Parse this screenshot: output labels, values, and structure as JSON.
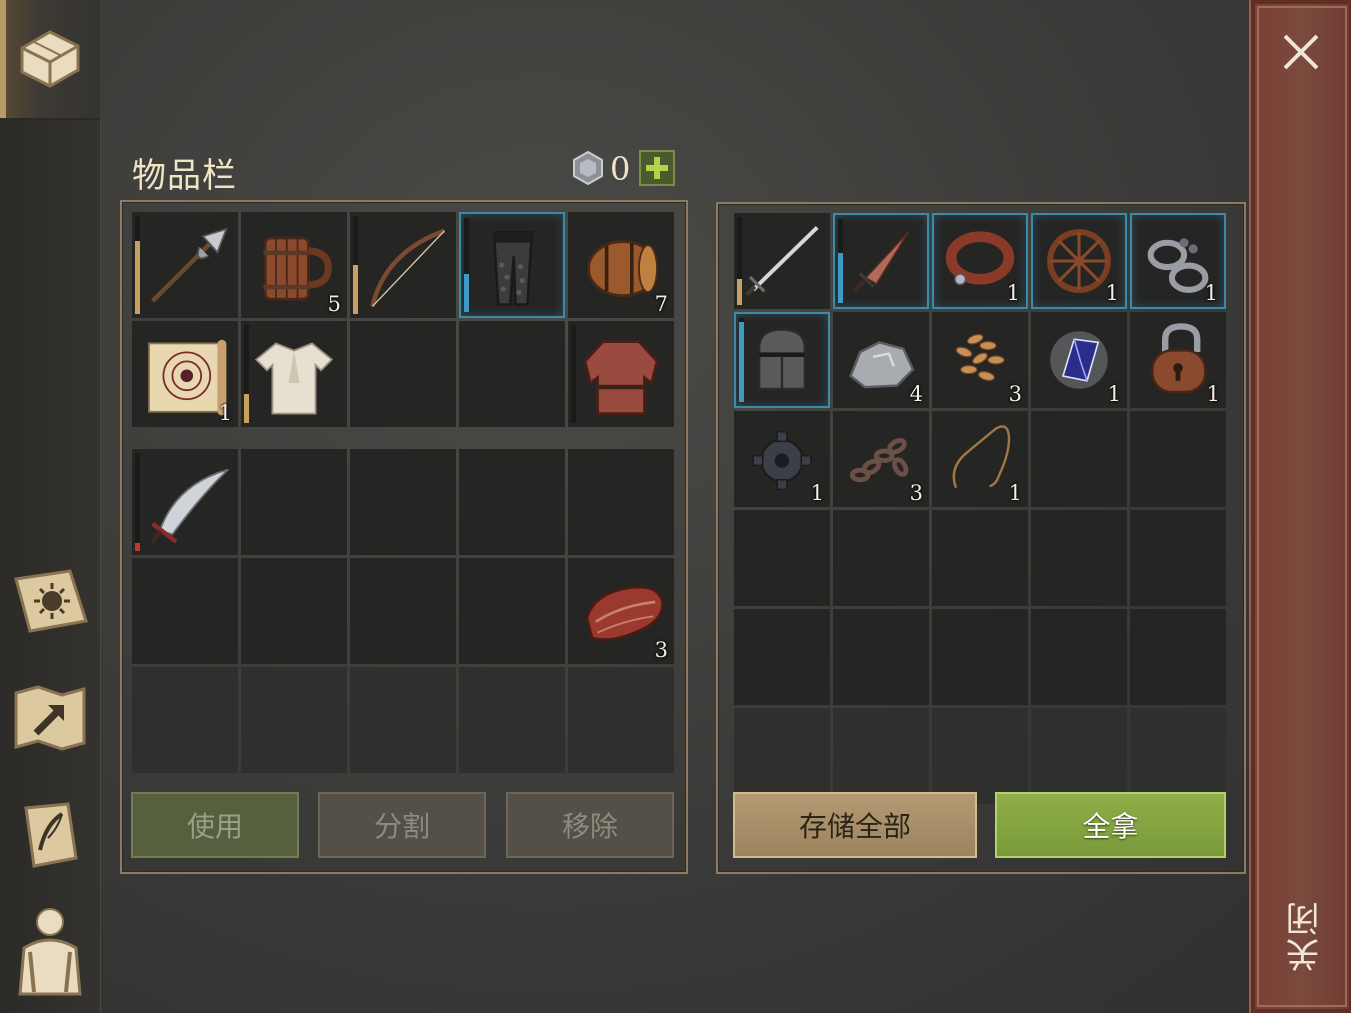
{
  "inventory": {
    "title": "物品栏",
    "coins": "0",
    "add_label": "+"
  },
  "buttons": {
    "use": "使用",
    "split": "分割",
    "remove": "移除",
    "store_all": "存储全部",
    "take_all": "全拿"
  },
  "close": {
    "label": "关闭"
  },
  "sidebar": {
    "icons": [
      "chest-icon",
      "crafting-book-icon",
      "map-icon",
      "quest-scroll-icon",
      "character-icon"
    ]
  },
  "colors": {
    "accent_blue": "#3a8aa8",
    "durability_tan": "#c8a062",
    "durability_blue": "#3e9cc4",
    "durability_red": "#c0392b",
    "take_green": "#8fae49"
  },
  "equip_slots": [
    {
      "icon": "halberd-icon",
      "qty": "",
      "dur": 0.75,
      "durColor": "#c8a062"
    },
    {
      "icon": "wooden-mug-icon",
      "qty": "5"
    },
    {
      "icon": "bow-icon",
      "qty": "",
      "dur": 0.5,
      "durColor": "#c8a062"
    },
    {
      "icon": "chainmail-leggings-icon",
      "qty": "",
      "selected": true,
      "dur": 0.4,
      "durColor": "#3e9cc4"
    },
    {
      "icon": "barrel-icon",
      "qty": "7"
    },
    {
      "icon": "recipe-scroll-icon",
      "qty": "1"
    },
    {
      "icon": "cloth-shirt-icon",
      "qty": "",
      "dur": 0.3,
      "durColor": "#c8a062"
    },
    {
      "icon": "",
      "qty": ""
    },
    {
      "icon": "",
      "qty": ""
    },
    {
      "icon": "chainmail-shirt-icon",
      "qty": "",
      "dur": 0.0,
      "durColor": "#c8a062"
    }
  ],
  "backpack_slots": [
    {
      "icon": "scimitar-icon",
      "qty": "",
      "dur": 0.08,
      "durColor": "#c0392b"
    },
    {
      "icon": "",
      "qty": ""
    },
    {
      "icon": "",
      "qty": ""
    },
    {
      "icon": "",
      "qty": ""
    },
    {
      "icon": "",
      "qty": ""
    },
    {
      "icon": "",
      "qty": ""
    },
    {
      "icon": "",
      "qty": ""
    },
    {
      "icon": "",
      "qty": ""
    },
    {
      "icon": "",
      "qty": ""
    },
    {
      "icon": "raw-meat-icon",
      "qty": "3"
    },
    {
      "icon": "",
      "qty": "",
      "faded": true
    },
    {
      "icon": "",
      "qty": "",
      "faded": true
    },
    {
      "icon": "",
      "qty": "",
      "faded": true
    },
    {
      "icon": "",
      "qty": "",
      "faded": true
    },
    {
      "icon": "",
      "qty": "",
      "faded": true
    }
  ],
  "container_slots": [
    {
      "icon": "longsword-icon",
      "qty": "",
      "dur": 0.3,
      "durColor": "#c8a062"
    },
    {
      "icon": "dagger-icon",
      "qty": "",
      "selected": true,
      "dur": 0.6,
      "durColor": "#3e9cc4"
    },
    {
      "icon": "leather-collar-icon",
      "qty": "1",
      "selected": true
    },
    {
      "icon": "wagon-wheel-icon",
      "qty": "1",
      "selected": true
    },
    {
      "icon": "iron-shackles-icon",
      "qty": "1",
      "selected": true
    },
    {
      "icon": "great-helm-icon",
      "qty": "",
      "selected": true,
      "dur": 0.95,
      "durColor": "#3e9cc4"
    },
    {
      "icon": "stone-ore-icon",
      "qty": "4"
    },
    {
      "icon": "wheat-seeds-icon",
      "qty": "3"
    },
    {
      "icon": "magic-crystal-icon",
      "qty": "1"
    },
    {
      "icon": "padlock-icon",
      "qty": "1"
    },
    {
      "icon": "gear-icon",
      "qty": "1"
    },
    {
      "icon": "chain-icon",
      "qty": "3"
    },
    {
      "icon": "rope-icon",
      "qty": "1"
    },
    {
      "icon": "",
      "qty": ""
    },
    {
      "icon": "",
      "qty": ""
    },
    {
      "icon": "",
      "qty": ""
    },
    {
      "icon": "",
      "qty": ""
    },
    {
      "icon": "",
      "qty": ""
    },
    {
      "icon": "",
      "qty": ""
    },
    {
      "icon": "",
      "qty": ""
    },
    {
      "icon": "",
      "qty": ""
    },
    {
      "icon": "",
      "qty": ""
    },
    {
      "icon": "",
      "qty": ""
    },
    {
      "icon": "",
      "qty": ""
    },
    {
      "icon": "",
      "qty": ""
    },
    {
      "icon": "",
      "qty": "",
      "faded": true
    },
    {
      "icon": "",
      "qty": "",
      "faded": true
    },
    {
      "icon": "",
      "qty": "",
      "faded": true
    },
    {
      "icon": "",
      "qty": "",
      "faded": true
    },
    {
      "icon": "",
      "qty": "",
      "faded": true
    }
  ]
}
